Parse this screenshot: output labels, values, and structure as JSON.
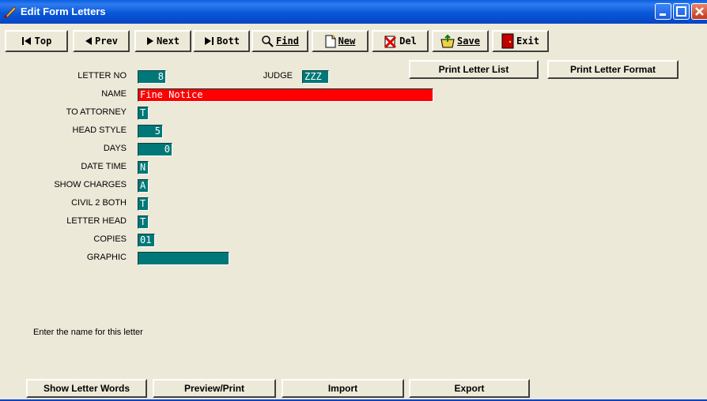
{
  "window": {
    "title": "Edit Form Letters"
  },
  "toolbar": {
    "top": "Top",
    "prev": "Prev",
    "next": "Next",
    "bott": "Bott",
    "find": "Find",
    "new": "New",
    "del": "Del",
    "save": "Save",
    "exit": "Exit"
  },
  "form": {
    "labels": {
      "letter_no": "LETTER NO",
      "judge": "JUDGE",
      "name": "NAME",
      "to_attorney": "TO ATTORNEY",
      "head_style": "HEAD STYLE",
      "days": "DAYS",
      "date_time": "DATE TIME",
      "show_charges": "SHOW CHARGES",
      "civil_2_both": "CIVIL 2 BOTH",
      "letter_head": "LETTER HEAD",
      "copies": "COPIES",
      "graphic": "GRAPHIC"
    },
    "values": {
      "letter_no": "8",
      "judge": "ZZZ",
      "name": "Fine Notice",
      "to_attorney": "T",
      "head_style": "5",
      "days": "0",
      "date_time": "N",
      "show_charges": "A",
      "civil_2_both": "T",
      "letter_head": "T",
      "copies": "01",
      "graphic": ""
    }
  },
  "buttons": {
    "print_list": "Print Letter List",
    "print_format": "Print Letter Format",
    "show_words": "Show Letter Words",
    "preview": "Preview/Print",
    "import": "Import",
    "export": "Export"
  },
  "status": {
    "message": "Enter the name for this letter"
  },
  "colors": {
    "field_bg": "#007878",
    "active_field_bg": "#ff0000",
    "titlebar": "#0a5fe0"
  }
}
